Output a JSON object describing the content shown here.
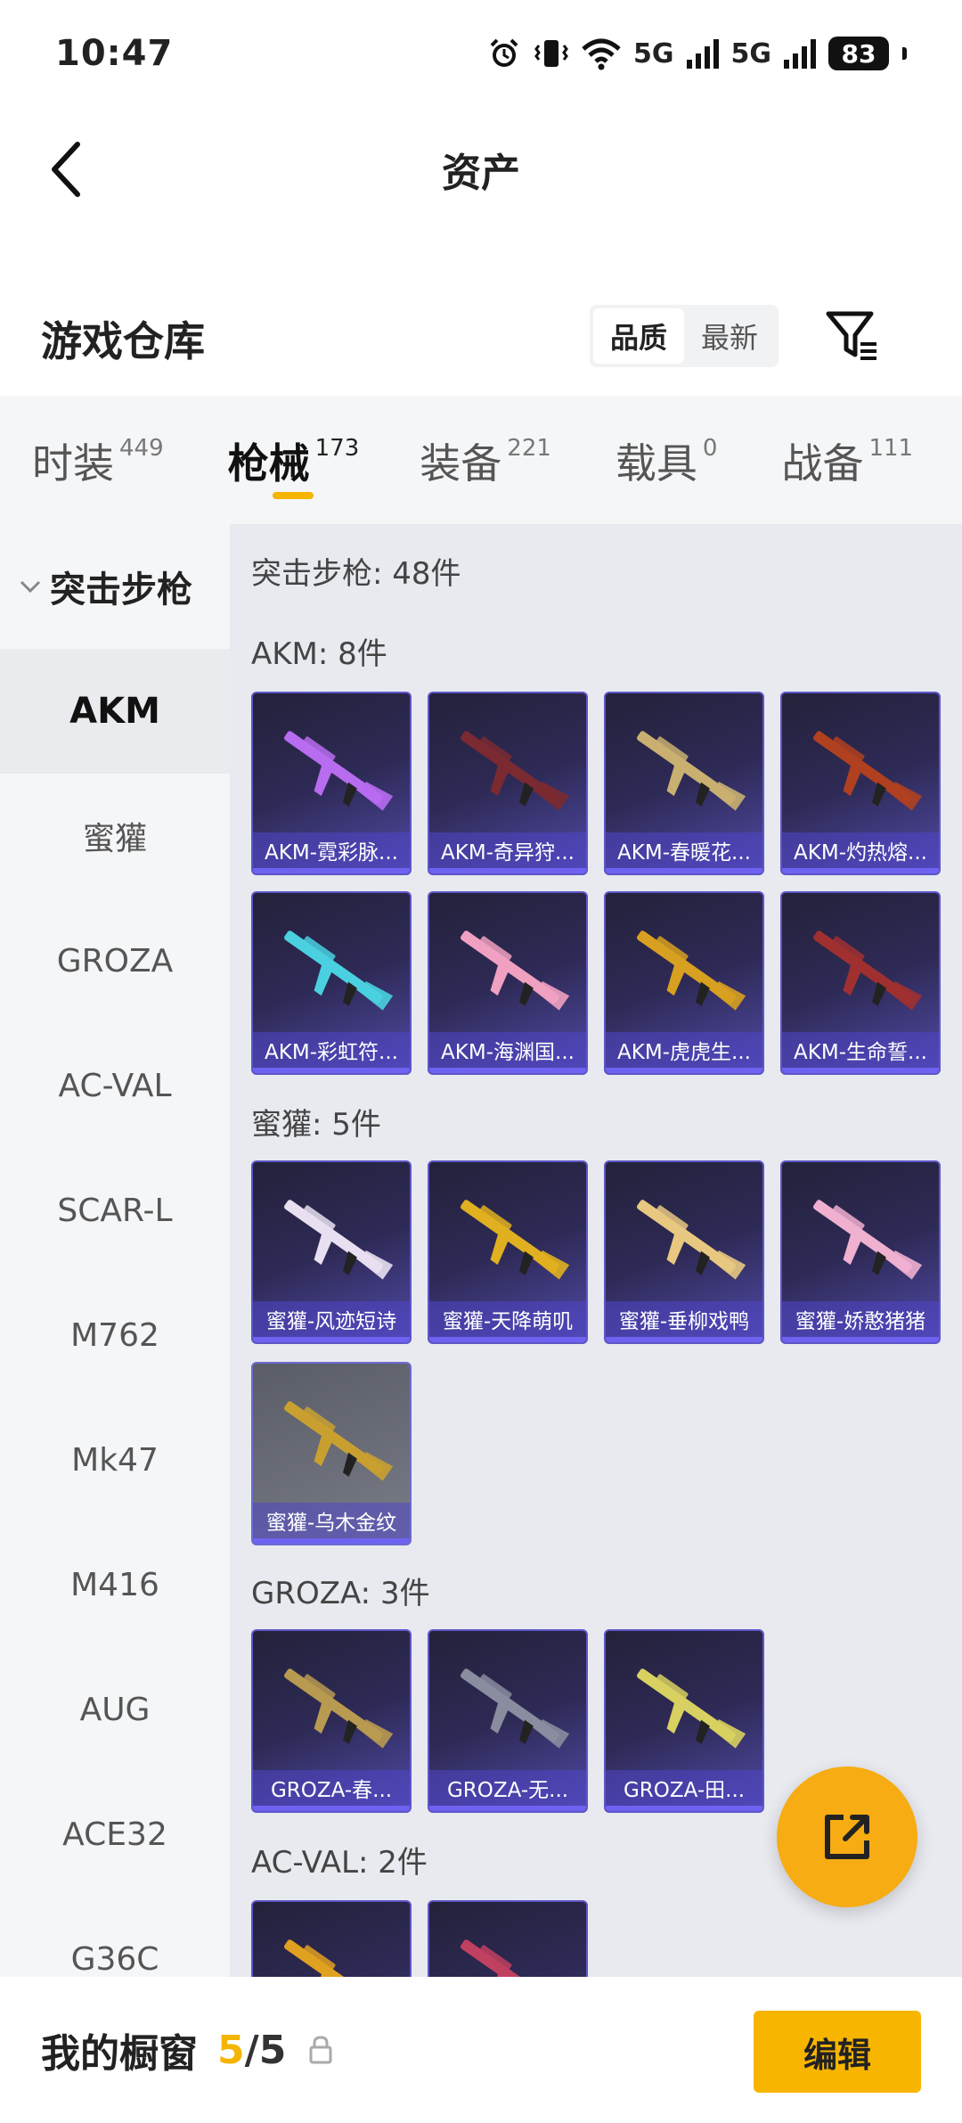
{
  "status_bar": {
    "time": "10:47",
    "net1": "5G",
    "net2": "5G",
    "battery": "83",
    "icons": [
      "alarm-icon",
      "vibrate-icon",
      "wifi-icon",
      "signal-icon",
      "signal-icon",
      "battery-icon"
    ]
  },
  "nav": {
    "title": "资产"
  },
  "warehouse": {
    "title": "游戏仓库",
    "sort_options": [
      "品质",
      "最新"
    ],
    "active_sort": "品质"
  },
  "tabs": [
    {
      "label": "时装",
      "count": "449"
    },
    {
      "label": "枪械",
      "count": "173",
      "active": true
    },
    {
      "label": "装备",
      "count": "221"
    },
    {
      "label": "载具",
      "count": "0"
    },
    {
      "label": "战备",
      "count": "111"
    }
  ],
  "sidebar": {
    "category": "突击步枪",
    "items": [
      "AKM",
      "蜜獾",
      "GROZA",
      "AC-VAL",
      "SCAR-L",
      "M762",
      "Mk47",
      "M416",
      "AUG",
      "ACE32",
      "G36C"
    ],
    "active": "AKM"
  },
  "content": {
    "summary": "突击步枪: 48件",
    "groups": [
      {
        "title": "AKM: 8件",
        "items": [
          "AKM-霓彩脉...",
          "AKM-奇异狩...",
          "AKM-春暖花...",
          "AKM-灼热熔...",
          "AKM-彩虹符...",
          "AKM-海渊国...",
          "AKM-虎虎生...",
          "AKM-生命誓..."
        ]
      },
      {
        "title": "蜜獾: 5件",
        "items": [
          "蜜獾-风迹短诗",
          "蜜獾-天降萌叽",
          "蜜獾-垂柳戏鸭",
          "蜜獾-娇憨猪猪",
          "蜜獾-乌木金纹"
        ]
      },
      {
        "title": "GROZA: 3件",
        "items": [
          "GROZA-春...",
          "GROZA-无...",
          "GROZA-田..."
        ]
      },
      {
        "title": "AC-VAL: 2件",
        "items": [
          "",
          ""
        ]
      }
    ]
  },
  "gun_colors": [
    "#b86cf0",
    "#7a2a30",
    "#c9b070",
    "#b04020",
    "#4ad0e0",
    "#f0a0c0",
    "#d8a020",
    "#a03030",
    "#e8e0f0",
    "#e0b020",
    "#e8c880",
    "#f0b0d0",
    "#c9a030",
    "#b89a50",
    "#8a8ca0",
    "#d8d060",
    "#e0a020",
    "#c04060"
  ],
  "bottom_bar": {
    "title": "我的橱窗",
    "current": "5",
    "sep_total": "/5",
    "edit_label": "编辑"
  },
  "theme": {
    "accent": "#f4b400",
    "card_border": "#5d56c6"
  }
}
